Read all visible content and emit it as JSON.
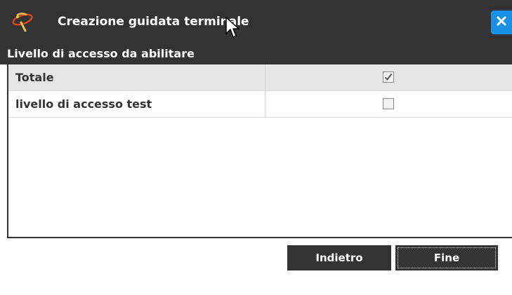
{
  "window": {
    "title": "Creazione guidata terminale",
    "icon": "wizard-app-icon",
    "close_icon": "close-icon",
    "accent_color": "#1a8fe8",
    "header_color": "#333333"
  },
  "section": {
    "title": "Livello di accesso da abilitare"
  },
  "grid": {
    "rows": [
      {
        "label": "Totale",
        "checked": true
      },
      {
        "label": "livello di accesso test",
        "checked": false
      }
    ]
  },
  "buttons": {
    "back_label": "Indietro",
    "finish_label": "Fine"
  }
}
